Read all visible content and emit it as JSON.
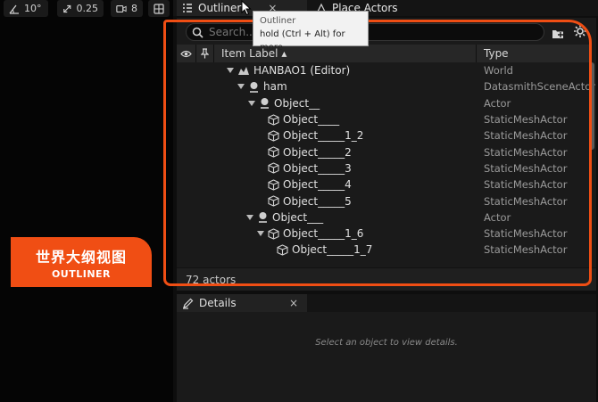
{
  "viewport_toolbar": {
    "angle_snap": "10°",
    "scale_snap": "0.25",
    "camera_speed": "8"
  },
  "badge": {
    "title_cn": "世界大纲视图",
    "title_en": "OUTLINER"
  },
  "tabs": {
    "outliner": "Outliner",
    "place_actors": "Place Actors",
    "close": "×"
  },
  "tooltip": {
    "title": "Outliner",
    "text": "hold (Ctrl + Alt) for more"
  },
  "search": {
    "placeholder": "Search..."
  },
  "columns": {
    "label": "Item Label ▴",
    "type": "Type"
  },
  "rows": [
    {
      "label": "HANBAO1 (Editor)",
      "type": "World"
    },
    {
      "label": "ham",
      "type": "DatasmithSceneActor"
    },
    {
      "label": "Object__",
      "type": "Actor"
    },
    {
      "label": "Object____",
      "type": "StaticMeshActor"
    },
    {
      "label": "Object_____1_2",
      "type": "StaticMeshActor"
    },
    {
      "label": "Object_____2",
      "type": "StaticMeshActor"
    },
    {
      "label": "Object_____3",
      "type": "StaticMeshActor"
    },
    {
      "label": "Object_____4",
      "type": "StaticMeshActor"
    },
    {
      "label": "Object_____5",
      "type": "StaticMeshActor"
    },
    {
      "label": "Object___",
      "type": "Actor"
    },
    {
      "label": "Object_____1_6",
      "type": "StaticMeshActor"
    },
    {
      "label": "Object_____1_7",
      "type": "StaticMeshActor"
    }
  ],
  "footer": {
    "count": "72 actors"
  },
  "details": {
    "tab": "Details",
    "close": "×",
    "hint": "Select an object to view details."
  },
  "colors": {
    "accent": "#f04e14"
  }
}
